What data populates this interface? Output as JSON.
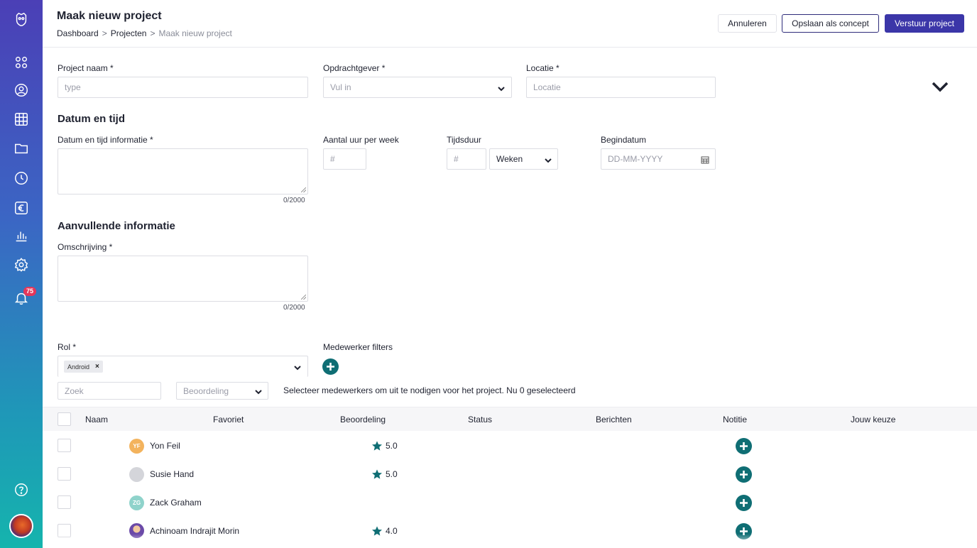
{
  "sidebar": {
    "icons": [
      "logo-icon",
      "dashboard-icon",
      "user-icon",
      "calendar-icon",
      "folder-icon",
      "clock-icon",
      "euro-icon",
      "chart-icon",
      "settings-icon",
      "bell-icon",
      "help-icon"
    ],
    "notification_count": "75"
  },
  "header": {
    "title": "Maak nieuw project",
    "breadcrumb": [
      "Dashboard",
      "Projecten",
      "Maak nieuw project"
    ],
    "breadcrumb_sep": ">",
    "cancel_label": "Annuleren",
    "draft_label": "Opslaan als concept",
    "send_label": "Verstuur project"
  },
  "form": {
    "project_name_label": "Project naam *",
    "project_name_placeholder": "type",
    "client_label": "Opdrachtgever *",
    "client_placeholder": "Vul in",
    "location_label": "Locatie *",
    "location_placeholder": "Locatie",
    "datetime_section": "Datum en tijd",
    "datetime_info_label": "Datum en tijd informatie *",
    "datetime_counter": "0/2000",
    "hours_label": "Aantal uur per week",
    "hours_placeholder": "#",
    "duration_label": "Tijdsduur",
    "duration_placeholder": "#",
    "duration_unit": "Weken",
    "start_label": "Begindatum",
    "start_placeholder": "DD-MM-YYYY",
    "extra_section": "Aanvullende informatie",
    "description_label": "Omschrijving *",
    "description_counter": "0/2000",
    "role_label": "Rol *",
    "role_chip": "Android",
    "role_chip_remove": "×",
    "employee_filters_label": "Medewerker filters",
    "search_placeholder": "Zoek",
    "rating_placeholder": "Beoordeling",
    "select_info": "Selecteer medewerkers om uit te nodigen voor het project. Nu 0 geselecteerd"
  },
  "table": {
    "columns": [
      "Naam",
      "Favoriet",
      "Beoordeling",
      "Status",
      "Berichten",
      "Notitie",
      "Jouw keuze"
    ],
    "rows": [
      {
        "initials": "YF",
        "avatar_color": "#f3b35d",
        "name": "Yon Feil",
        "rating": "5.0"
      },
      {
        "initials": "",
        "avatar_color": "#d4d5da",
        "name": "Susie Hand",
        "rating": "5.0"
      },
      {
        "initials": "ZG",
        "avatar_color": "#8fd3cb",
        "name": "Zack Graham",
        "rating": ""
      },
      {
        "initials": "",
        "avatar_color": "#6b4aa8",
        "name": "Achinoam Indrajit Morin",
        "rating": "4.0"
      }
    ]
  },
  "colors": {
    "accent": "#3b36a8",
    "teal": "#0f6e74"
  }
}
